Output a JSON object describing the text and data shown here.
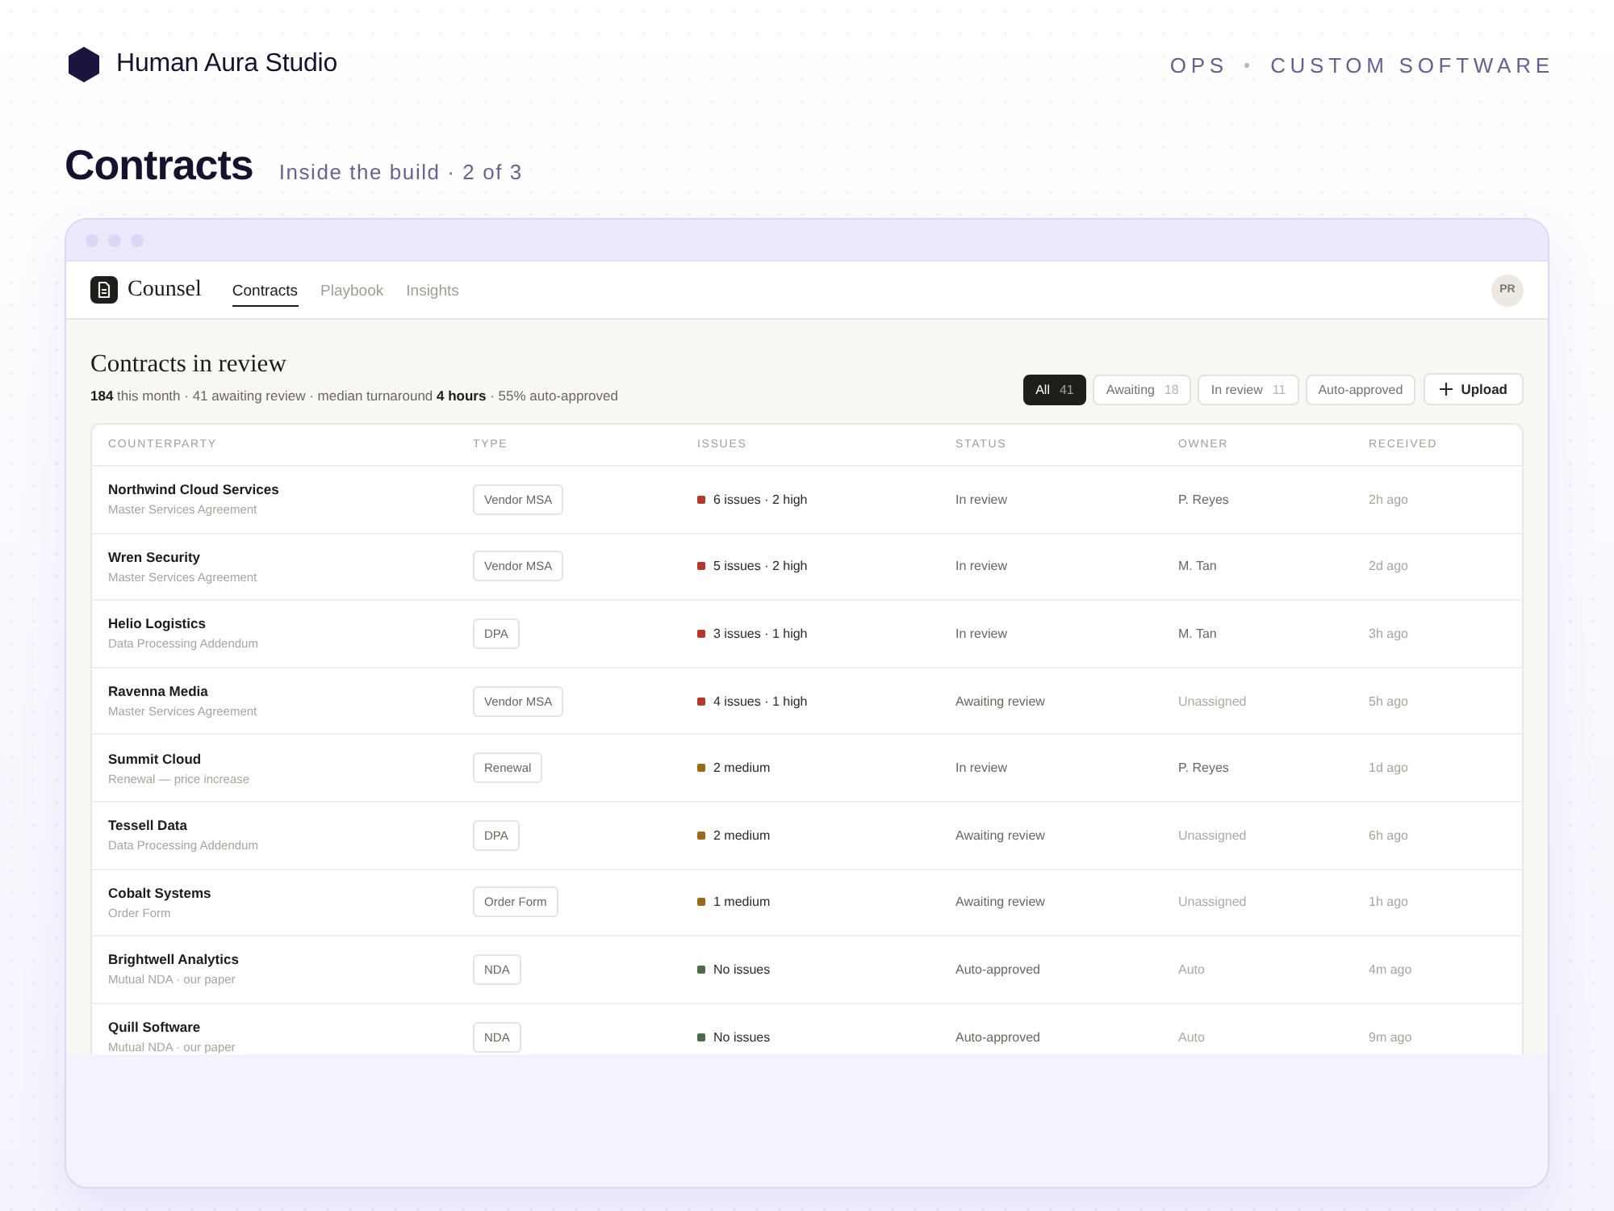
{
  "brand": {
    "name": "Human Aura Studio"
  },
  "header_tags": [
    "OPS",
    "CUSTOM SOFTWARE"
  ],
  "page": {
    "title": "Contracts",
    "subtitle": "Inside the build · 2 of 3"
  },
  "app": {
    "name": "Counsel",
    "tabs": [
      {
        "label": "Contracts",
        "selected": true
      },
      {
        "label": "Playbook",
        "selected": false
      },
      {
        "label": "Insights",
        "selected": false
      }
    ],
    "avatar": "PR",
    "heading": "Contracts in review",
    "summary": "**184** this month · 41 awaiting review · median turnaround **4 hours** · 55% auto-approved",
    "filters": [
      {
        "label": "All",
        "count": "41",
        "selected": true
      },
      {
        "label": "Awaiting",
        "count": "18",
        "selected": false
      },
      {
        "label": "In review",
        "count": "11",
        "selected": false
      },
      {
        "label": "Auto-approved",
        "selected": false
      }
    ],
    "upload_button": "Upload",
    "table": {
      "columns": [
        "COUNTERPARTY",
        "TYPE",
        "ISSUES",
        "STATUS",
        "OWNER",
        "RECEIVED"
      ],
      "rows": [
        {
          "counterparty": "Northwind Cloud Services",
          "description": "Master Services Agreement",
          "type": "Vendor MSA",
          "issues": {
            "text": "6 issues · 2 high",
            "color": "#b0392c"
          },
          "status": "In review",
          "owner": "P. Reyes",
          "owner_muted": false,
          "received": "2h ago"
        },
        {
          "counterparty": "Wren Security",
          "description": "Master Services Agreement",
          "type": "Vendor MSA",
          "issues": {
            "text": "5 issues · 2 high",
            "color": "#b0392c"
          },
          "status": "In review",
          "owner": "M. Tan",
          "owner_muted": false,
          "received": "2d ago"
        },
        {
          "counterparty": "Helio Logistics",
          "description": "Data Processing Addendum",
          "type": "DPA",
          "issues": {
            "text": "3 issues · 1 high",
            "color": "#b0392c"
          },
          "status": "In review",
          "owner": "M. Tan",
          "owner_muted": false,
          "received": "3h ago"
        },
        {
          "counterparty": "Ravenna Media",
          "description": "Master Services Agreement",
          "type": "Vendor MSA",
          "issues": {
            "text": "4 issues · 1 high",
            "color": "#b0392c"
          },
          "status": "Awaiting review",
          "owner": "Unassigned",
          "owner_muted": true,
          "received": "5h ago"
        },
        {
          "counterparty": "Summit Cloud",
          "description": "Renewal — price increase",
          "type": "Renewal",
          "issues": {
            "text": "2 medium",
            "color": "#9a6a1c"
          },
          "status": "In review",
          "owner": "P. Reyes",
          "owner_muted": false,
          "received": "1d ago"
        },
        {
          "counterparty": "Tessell Data",
          "description": "Data Processing Addendum",
          "type": "DPA",
          "issues": {
            "text": "2 medium",
            "color": "#9a6a1c"
          },
          "status": "Awaiting review",
          "owner": "Unassigned",
          "owner_muted": true,
          "received": "6h ago"
        },
        {
          "counterparty": "Cobalt Systems",
          "description": "Order Form",
          "type": "Order Form",
          "issues": {
            "text": "1 medium",
            "color": "#9a6a1c"
          },
          "status": "Awaiting review",
          "owner": "Unassigned",
          "owner_muted": true,
          "received": "1h ago"
        },
        {
          "counterparty": "Brightwell Analytics",
          "description": "Mutual NDA · our paper",
          "type": "NDA",
          "issues": {
            "text": "No issues",
            "color": "#4b6b4b"
          },
          "status": "Auto-approved",
          "owner": "Auto",
          "owner_muted": true,
          "received": "4m ago"
        },
        {
          "counterparty": "Quill Software",
          "description": "Mutual NDA · our paper",
          "type": "NDA",
          "issues": {
            "text": "No issues",
            "color": "#4b6b4b"
          },
          "status": "Auto-approved",
          "owner": "Auto",
          "owner_muted": true,
          "received": "9m ago"
        }
      ]
    }
  }
}
